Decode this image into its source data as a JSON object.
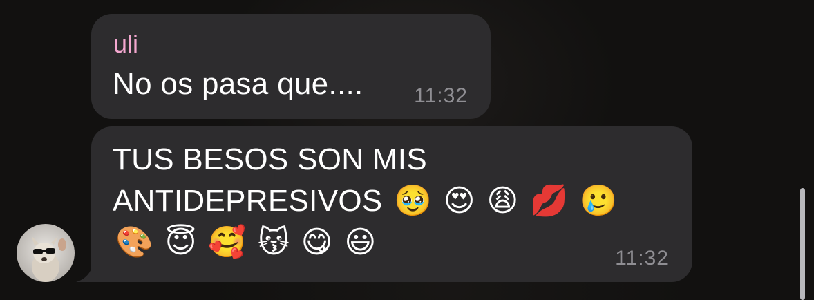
{
  "chat": {
    "messages": [
      {
        "sender": "uli",
        "text": "No os pasa que....",
        "time": "11:32"
      },
      {
        "text_line1": "TUS BESOS SON MIS",
        "text_line2": "ANTIDEPRESIVOS",
        "emojis_line2": [
          "🥹",
          "😍",
          "😩",
          "💋",
          "🥲"
        ],
        "emojis_line3": [
          "🎨",
          "😇",
          "🥰",
          "😽",
          "😋",
          "😃"
        ],
        "time": "11:32"
      }
    ]
  },
  "colors": {
    "bubble": "#2d2c2e",
    "sender": "#f3a7cf",
    "time": "#8f8e93",
    "text": "#ffffff"
  }
}
